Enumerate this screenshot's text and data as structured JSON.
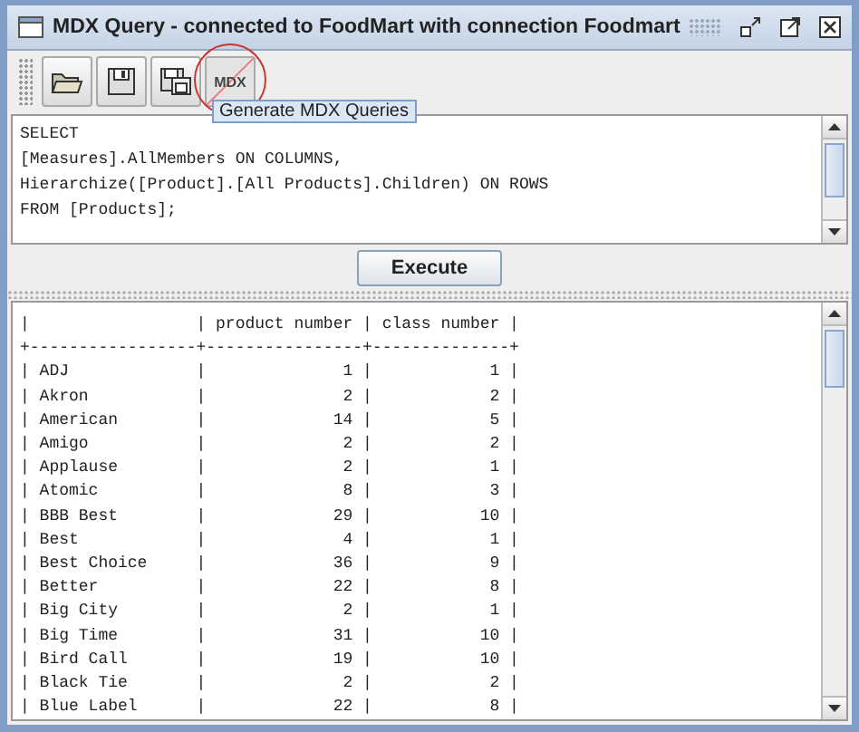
{
  "window": {
    "title": "MDX Query - connected to FoodMart with connection Foodmart"
  },
  "toolbar": {
    "mdx_label": "MDX",
    "tooltip": "Generate MDX Queries"
  },
  "query": {
    "lines": [
      "SELECT",
      "[Measures].AllMembers ON COLUMNS,",
      "Hierarchize([Product].[All Products].Children) ON ROWS",
      "FROM [Products];"
    ]
  },
  "execute_button": "Execute",
  "output": {
    "lines": [
      "|                 | product number | class number |",
      "+-----------------+----------------+--------------+",
      "| ADJ             |              1 |            1 |",
      "| Akron           |              2 |            2 |",
      "| American        |             14 |            5 |",
      "| Amigo           |              2 |            2 |",
      "| Applause        |              2 |            1 |",
      "| Atomic          |              8 |            3 |",
      "| BBB Best        |             29 |           10 |",
      "| Best            |              4 |            1 |",
      "| Best Choice     |             36 |            9 |",
      "| Better          |             22 |            8 |",
      "| Big City        |              2 |            1 |",
      "| Big Time        |             31 |           10 |",
      "| Bird Call       |             19 |           10 |",
      "| Black Tie       |              2 |            2 |",
      "| Blue Label      |             22 |            8 |"
    ]
  }
}
